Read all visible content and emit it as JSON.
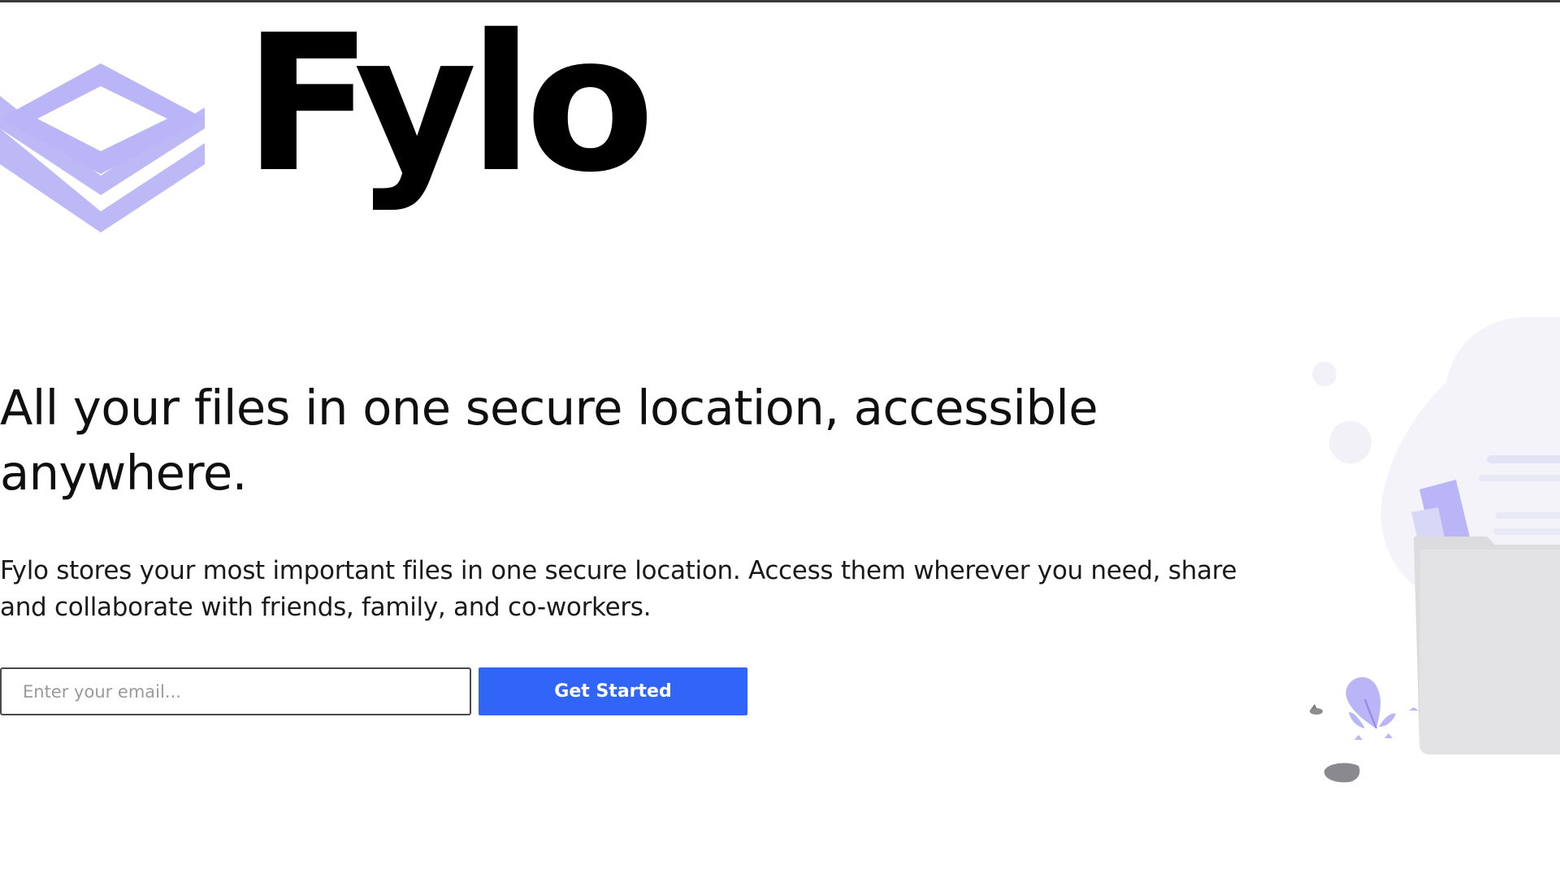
{
  "brand": {
    "name": "Fylo",
    "accent_color": "#b9b5f7",
    "primary_color": "hsl(224, 93%, 58%)"
  },
  "hero": {
    "headline": "All your files in one secure location, accessible anywhere.",
    "description": "Fylo stores your most important files in one secure location. Access them wherever you need, share and collaborate with friends, family, and co-workers."
  },
  "signup": {
    "email_placeholder": "Enter your email...",
    "email_value": "",
    "button_label": "Get Started"
  },
  "icons": {
    "logo_mark": "stacked-layers-icon",
    "illustration": "files-folder-illustration"
  }
}
